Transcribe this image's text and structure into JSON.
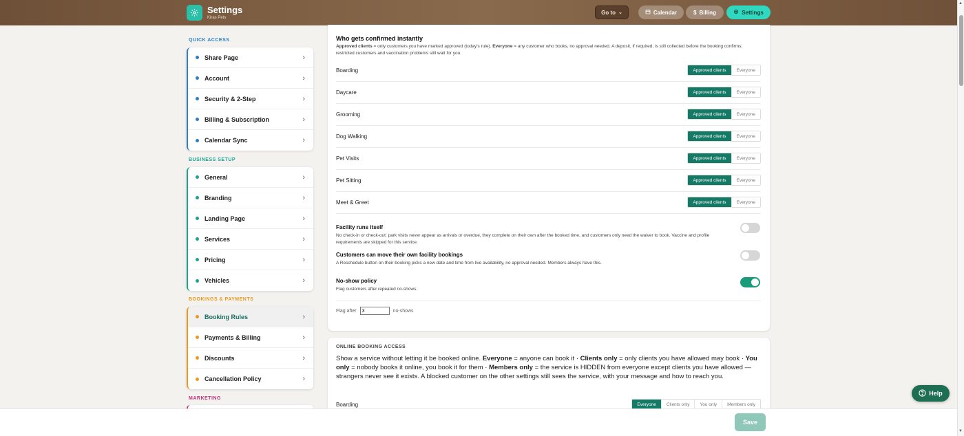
{
  "app": {
    "title": "Settings",
    "subtitle": "Kiras Pets"
  },
  "topbar": {
    "goto_label": "Go to",
    "calendar_label": "Calendar",
    "billing_label": "Billing",
    "settings_label": "Settings"
  },
  "sidebar": {
    "quick_access": {
      "label": "QUICK ACCESS",
      "color": "#2f7fc1",
      "items": [
        {
          "label": "Share Page"
        },
        {
          "label": "Account"
        },
        {
          "label": "Security & 2-Step"
        },
        {
          "label": "Billing & Subscription"
        },
        {
          "label": "Calendar Sync"
        }
      ]
    },
    "business_setup": {
      "label": "BUSINESS SETUP",
      "color": "#1aa58e",
      "items": [
        {
          "label": "General"
        },
        {
          "label": "Branding"
        },
        {
          "label": "Landing Page"
        },
        {
          "label": "Services"
        },
        {
          "label": "Pricing"
        },
        {
          "label": "Vehicles"
        }
      ]
    },
    "bookings_payments": {
      "label": "BOOKINGS & PAYMENTS",
      "color": "#e89a1c",
      "items": [
        {
          "label": "Booking Rules"
        },
        {
          "label": "Payments & Billing"
        },
        {
          "label": "Discounts"
        },
        {
          "label": "Cancellation Policy"
        }
      ]
    },
    "marketing": {
      "label": "MARKETING",
      "color": "#c0337a"
    }
  },
  "confirm": {
    "title": "Who gets confirmed instantly",
    "desc_a": "Approved clients",
    "desc_b": " = only customers you have marked approved (today's rule). ",
    "desc_c": "Everyone",
    "desc_d": " = any customer who books, no approval needed. A deposit, if required, is still collected before the booking confirms; restricted customers and vaccination problems still wait for you.",
    "option_approved": "Approved clients",
    "option_everyone": "Everyone",
    "services": [
      {
        "label": "Boarding",
        "selected": "Approved clients"
      },
      {
        "label": "Daycare",
        "selected": "Approved clients"
      },
      {
        "label": "Grooming",
        "selected": "Approved clients"
      },
      {
        "label": "Dog Walking",
        "selected": "Approved clients"
      },
      {
        "label": "Pet Visits",
        "selected": "Approved clients"
      },
      {
        "label": "Pet Sitting",
        "selected": "Approved clients"
      },
      {
        "label": "Meet & Greet",
        "selected": "Approved clients"
      }
    ]
  },
  "toggles": {
    "facility": {
      "title": "Facility runs itself",
      "desc": "No check-in or check-out: park visits never appear as arrivals or overdue, they complete on their own after the booked time, and customers only need the waiver to book. Vaccine and profile requirements are skipped for this service.",
      "on": false
    },
    "move": {
      "title": "Customers can move their own facility bookings",
      "desc": "A Reschedule button on their booking picks a new date and time from live availability, no approval needed. Members always have this.",
      "on": false
    },
    "noshow": {
      "title": "No-show policy",
      "desc": "Flag customers after repeated no-shows.",
      "on": true
    }
  },
  "flag": {
    "prefix": "Flag after",
    "value": "3",
    "suffix": "no-shows"
  },
  "online": {
    "title": "ONLINE BOOKING ACCESS",
    "t1": "Show a service without letting it be booked online. ",
    "b1": "Everyone",
    "t2": " = anyone can book it · ",
    "b2": "Clients only",
    "t3": " = only clients you have allowed may book · ",
    "b3": "You only",
    "t4": " = nobody books it online, you book it for them · ",
    "b4": "Members only",
    "t5": " = the service is HIDDEN from everyone except clients you have allowed — strangers never see it exists. A blocked customer on the other settings still sees the service, with your message and how to reach you.",
    "row_label": "Boarding",
    "options": [
      "Everyone",
      "Clients only",
      "You only",
      "Members only"
    ],
    "selected": "Everyone"
  },
  "footer": {
    "save_label": "Save",
    "help_label": "Help"
  },
  "colors": {
    "accent": "#147a66",
    "topbar": "#7a5a40",
    "settings_pill": "#2fd8be"
  }
}
